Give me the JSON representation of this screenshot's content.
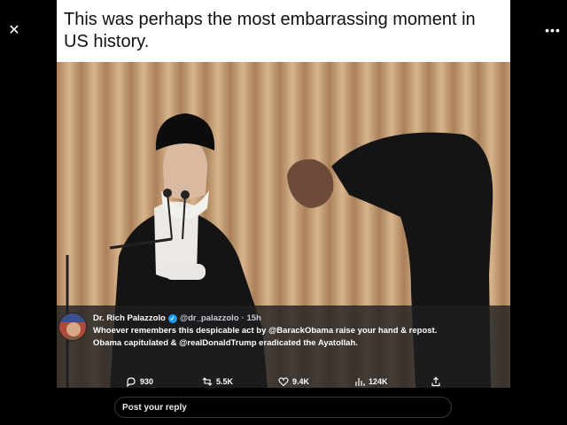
{
  "viewer": {
    "close_glyph": "✕",
    "more_glyph": "•••"
  },
  "image": {
    "caption": "This was perhaps the most embarrassing moment in US history."
  },
  "tweet": {
    "author_name": "Dr. Rich Palazzolo",
    "handle": "@dr_palazzolo",
    "time": "· 15h",
    "text": "Whoever remembers this despicable act by @BarackObama raise your hand & repost. Obama capitulated & @realDonaldTrump eradicated the Ayatollah."
  },
  "actions": {
    "replies": "930",
    "reposts": "5.5K",
    "likes": "9.4K",
    "views": "124K"
  },
  "reply": {
    "placeholder": "Post your reply"
  },
  "colors": {
    "background": "#000000",
    "verified": "#1d9bf0",
    "curtain": "#c9a27a"
  }
}
